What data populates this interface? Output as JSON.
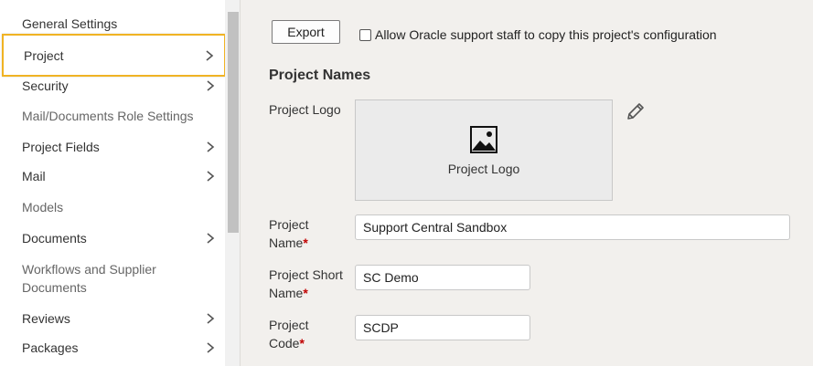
{
  "sidebar": {
    "items": [
      {
        "label": "General Settings",
        "chevron": false,
        "enabled": true
      },
      {
        "label": "Project",
        "chevron": true,
        "enabled": true,
        "selected": true
      },
      {
        "label": "Security",
        "chevron": true,
        "enabled": true
      },
      {
        "label": "Mail/Documents Role Settings",
        "chevron": false,
        "enabled": false
      },
      {
        "label": "Project Fields",
        "chevron": true,
        "enabled": true
      },
      {
        "label": "Mail",
        "chevron": true,
        "enabled": true
      },
      {
        "label": "Models",
        "chevron": false,
        "enabled": false
      },
      {
        "label": "Documents",
        "chevron": true,
        "enabled": true
      },
      {
        "label": "Workflows and Supplier",
        "label2": "Documents",
        "chevron": false,
        "enabled": false
      },
      {
        "label": "Reviews",
        "chevron": true,
        "enabled": true
      },
      {
        "label": "Packages",
        "chevron": true,
        "enabled": true
      }
    ],
    "selected_border_color": "#f0b323"
  },
  "toolbar": {
    "export_label": "Export",
    "allow_support_label": "Allow Oracle support staff to copy this project's configuration"
  },
  "main": {
    "section_title": "Project Names",
    "logo": {
      "label": "Project Logo",
      "placeholder_caption": "Project Logo",
      "icon": "image-placeholder-icon",
      "edit_icon": "pencil-icon"
    },
    "fields": {
      "project_name": {
        "label_line1": "Project",
        "label_line2": "Name",
        "required_mark": "*",
        "value": "Support Central Sandbox"
      },
      "short_name": {
        "label_line1": "Project Short",
        "label_line2": "Name",
        "required_mark": "*",
        "value": "SC Demo"
      },
      "code": {
        "label_line1": "Project",
        "label_line2": "Code",
        "required_mark": "*",
        "value": "SCDP"
      }
    }
  }
}
